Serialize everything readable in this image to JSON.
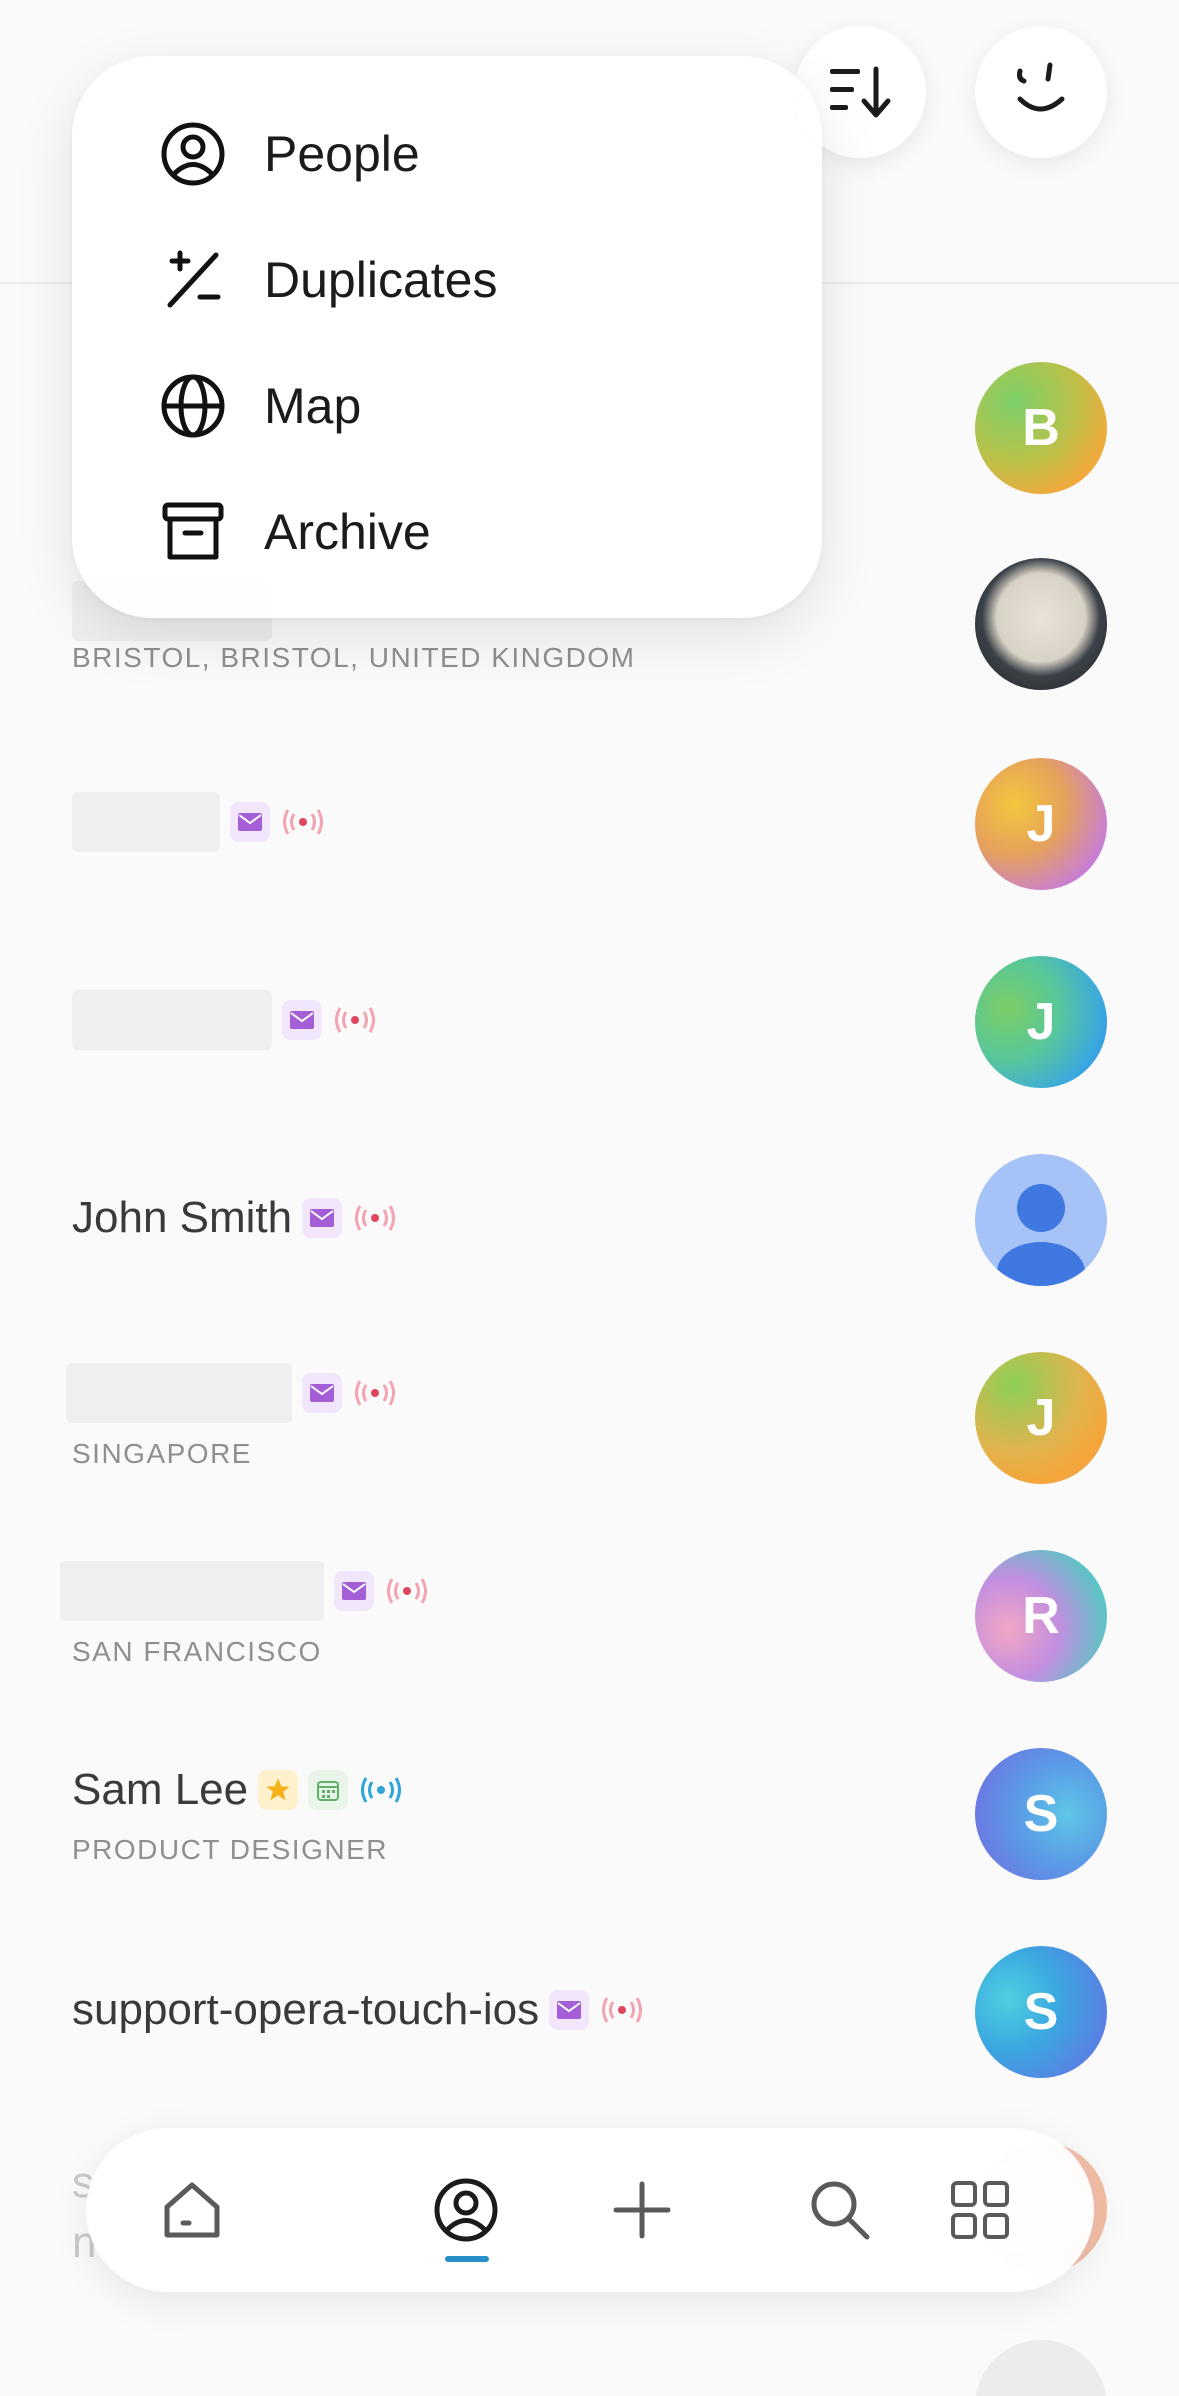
{
  "menu": {
    "items": [
      {
        "label": "People",
        "icon": "person-circle-icon"
      },
      {
        "label": "Duplicates",
        "icon": "duplicates-icon"
      },
      {
        "label": "Map",
        "icon": "globe-icon"
      },
      {
        "label": "Archive",
        "icon": "archive-box-icon"
      }
    ]
  },
  "header": {
    "sort_icon": "sort-descending-icon",
    "assistant_icon": "smiley-face-icon"
  },
  "contacts": [
    {
      "name": "",
      "subtitle": "",
      "avatar_letter": "B",
      "badges": []
    },
    {
      "name": "",
      "subtitle": "BRISTOL, BRISTOL, UNITED KINGDOM",
      "avatar_letter": "",
      "badges": []
    },
    {
      "name": "",
      "subtitle": "",
      "avatar_letter": "J",
      "badges": [
        "mail",
        "signal"
      ]
    },
    {
      "name": "",
      "subtitle": "",
      "avatar_letter": "J",
      "badges": [
        "mail",
        "signal"
      ]
    },
    {
      "name": "John Smith",
      "subtitle": "",
      "avatar_letter": "",
      "badges": [
        "mail",
        "signal"
      ]
    },
    {
      "name": "",
      "subtitle": "SINGAPORE",
      "avatar_letter": "J",
      "badges": [
        "mail",
        "signal"
      ]
    },
    {
      "name": "",
      "subtitle": "SAN FRANCISCO",
      "avatar_letter": "R",
      "badges": [
        "mail",
        "signal"
      ]
    },
    {
      "name": "Sam Lee",
      "subtitle": "PRODUCT DESIGNER",
      "avatar_letter": "S",
      "badges": [
        "star",
        "calendar",
        "signal-blue"
      ]
    },
    {
      "name": "support-opera-touch-ios",
      "subtitle": "",
      "avatar_letter": "S",
      "badges": [
        "mail",
        "signal"
      ]
    }
  ],
  "bottom_nav": {
    "items": [
      {
        "icon": "home-icon"
      },
      {
        "icon": "people-icon",
        "active": true
      },
      {
        "icon": "plus-icon"
      },
      {
        "icon": "search-icon"
      },
      {
        "icon": "grid-icon"
      }
    ]
  },
  "colors": {
    "accent": "#2a8fc8",
    "mail_badge": "#a45fd6",
    "signal_badge": "#e0455e",
    "signal_blue": "#2ea6d9",
    "star": "#f5b21a"
  }
}
